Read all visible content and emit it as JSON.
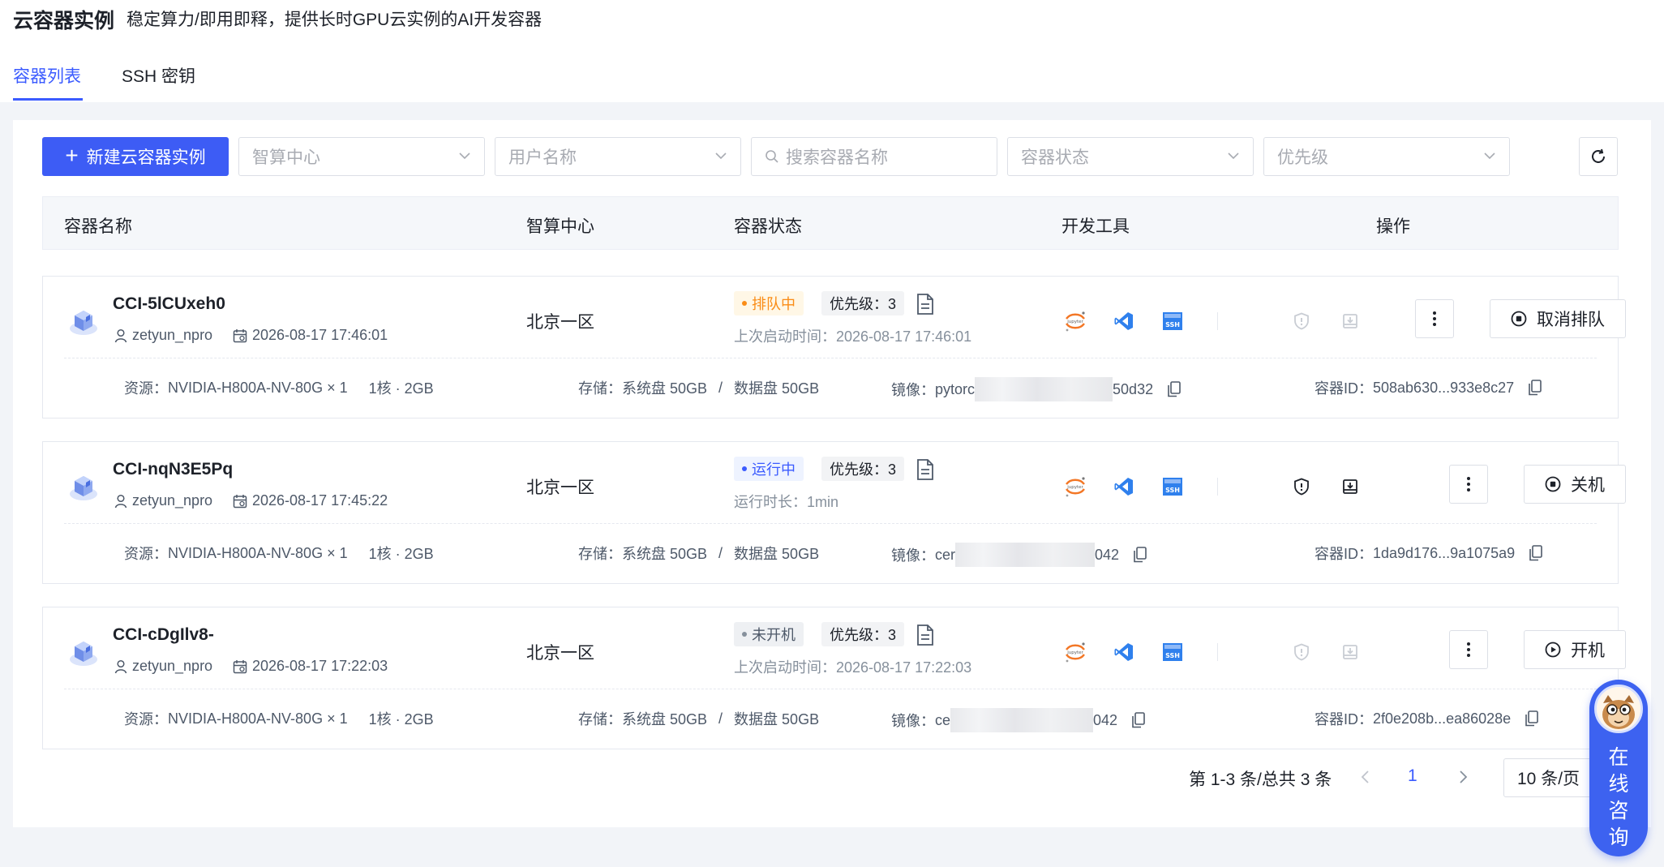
{
  "header": {
    "title": "云容器实例",
    "subtitle": "稳定算力/即用即释，提供长时GPU云实例的AI开发容器",
    "tabs": [
      {
        "label": "容器列表",
        "active": true
      },
      {
        "label": "SSH 密钥",
        "active": false
      }
    ]
  },
  "toolbar": {
    "new_button": "新建云容器实例",
    "filters": {
      "center": "智算中心",
      "user": "用户名称",
      "search": "搜索容器名称",
      "status": "容器状态",
      "priority": "优先级"
    }
  },
  "table": {
    "columns": [
      "容器名称",
      "智算中心",
      "容器状态",
      "开发工具",
      "操作"
    ]
  },
  "rows": [
    {
      "name": "CCI-5lCUxeh0",
      "user": "zetyun_npro",
      "created": "2026-08-17 17:46:01",
      "center": "北京一区",
      "status": "排队中",
      "status_type": "queue",
      "priority": "优先级：3",
      "status_line": "上次启动时间：2026-08-17 17:46:01",
      "tools_enabled": false,
      "action": "取消排队",
      "action_icon": "stop-circle-icon",
      "resource_label": "资源：",
      "resource": "NVIDIA-H800A-NV-80G × 1",
      "cpu_mem": "1核 · 2GB",
      "storage_label": "存储：",
      "storage": "系统盘 50GB",
      "storage_sep": "/",
      "data_disk": "数据盘 50GB",
      "image_label": "镜像：",
      "image_prefix": "pytorc",
      "image_suffix": "50d32",
      "id_label": "容器ID：",
      "container_id": "508ab630...933e8c27"
    },
    {
      "name": "CCI-nqN3E5Pq",
      "user": "zetyun_npro",
      "created": "2026-08-17 17:45:22",
      "center": "北京一区",
      "status": "运行中",
      "status_type": "run",
      "priority": "优先级：3",
      "status_line": "运行时长：1min",
      "tools_enabled": true,
      "action": "关机",
      "action_icon": "stop-circle-icon",
      "resource_label": "资源：",
      "resource": "NVIDIA-H800A-NV-80G × 1",
      "cpu_mem": "1核 · 2GB",
      "storage_label": "存储：",
      "storage": "系统盘 50GB",
      "storage_sep": "/",
      "data_disk": "数据盘 50GB",
      "image_label": "镜像：",
      "image_prefix": "cer",
      "image_suffix": "042",
      "id_label": "容器ID：",
      "container_id": "1da9d176...9a1075a9"
    },
    {
      "name": "CCI-cDgIlv8-",
      "user": "zetyun_npro",
      "created": "2026-08-17 17:22:03",
      "center": "北京一区",
      "status": "未开机",
      "status_type": "off",
      "priority": "优先级：3",
      "status_line": "上次启动时间：2026-08-17 17:22:03",
      "tools_enabled": false,
      "action": "开机",
      "action_icon": "play-circle-icon",
      "resource_label": "资源：",
      "resource": "NVIDIA-H800A-NV-80G × 1",
      "cpu_mem": "1核 · 2GB",
      "storage_label": "存储：",
      "storage": "系统盘 50GB",
      "storage_sep": "/",
      "data_disk": "数据盘 50GB",
      "image_label": "镜像：",
      "image_prefix": "ce",
      "image_suffix": "042",
      "id_label": "容器ID：",
      "container_id": "2f0e208b...ea86028e"
    }
  ],
  "pagination": {
    "total": "第 1-3 条/总共 3 条",
    "current_page": "1",
    "page_size": "10 条/页"
  },
  "consult": {
    "label_chars": [
      "在",
      "线",
      "咨",
      "询"
    ]
  },
  "colors": {
    "primary": "#3d5cf5",
    "queue": "#fa8c16",
    "running": "#3b5bff",
    "off": "#86909c"
  },
  "icons": [
    "plus-icon",
    "chevron-down-icon",
    "search-icon",
    "refresh-icon",
    "container-cube-icon",
    "user-icon",
    "calendar-icon",
    "document-icon",
    "jupyter-icon",
    "vscode-icon",
    "ssh-icon",
    "shield-icon",
    "save-icon",
    "more-vertical-icon",
    "copy-icon",
    "chevron-left-icon",
    "chevron-right-icon",
    "assistant-avatar-icon"
  ]
}
